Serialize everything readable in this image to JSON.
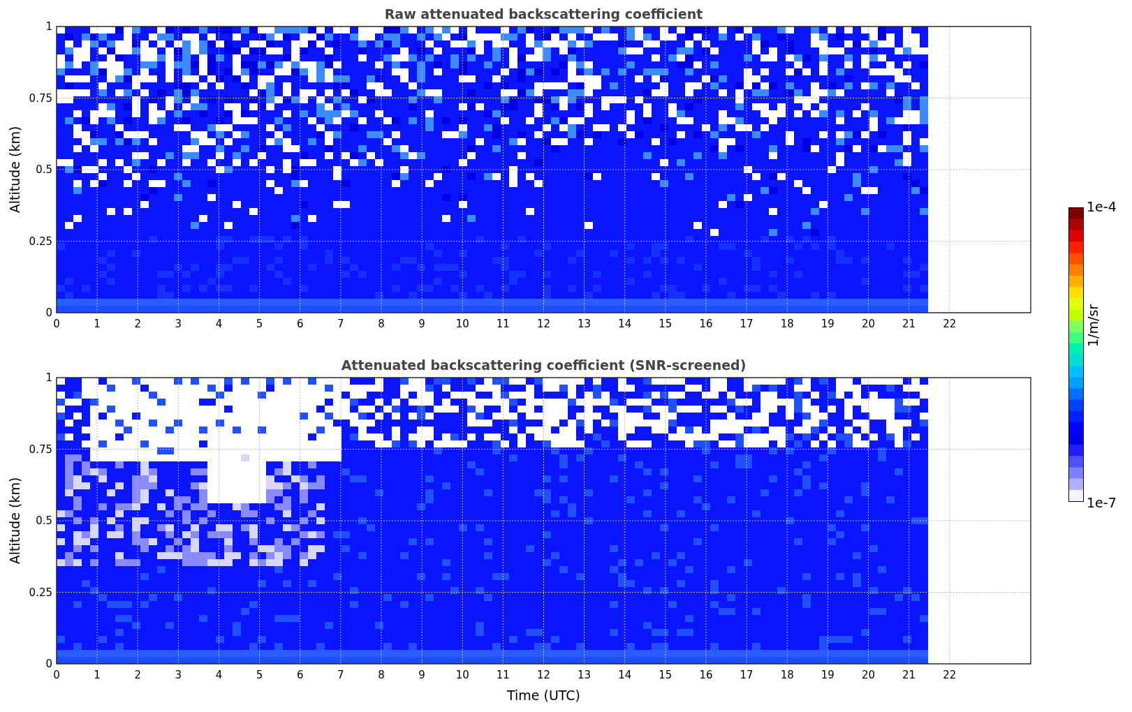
{
  "panels": [
    {
      "kind": "raw",
      "title": "Raw attenuated backscattering coefficient",
      "ylabel": "Altitude (km)",
      "yticks": [
        "1",
        "0.75",
        "0.5",
        "0.25",
        "0"
      ],
      "xticks": [
        "0",
        "1",
        "2",
        "3",
        "4",
        "5",
        "6",
        "7",
        "8",
        "9",
        "10",
        "11",
        "12",
        "13",
        "14",
        "15",
        "16",
        "17",
        "18",
        "19",
        "20",
        "21",
        "22"
      ]
    },
    {
      "kind": "screened",
      "title": "Attenuated backscattering coefficient (SNR-screened)",
      "ylabel": "Altitude (km)",
      "xlabel": "Time (UTC)",
      "yticks": [
        "1",
        "0.75",
        "0.5",
        "0.25",
        "0"
      ],
      "xticks": [
        "0",
        "1",
        "2",
        "3",
        "4",
        "5",
        "6",
        "7",
        "8",
        "9",
        "10",
        "11",
        "12",
        "13",
        "14",
        "15",
        "16",
        "17",
        "18",
        "19",
        "20",
        "21",
        "22"
      ]
    }
  ],
  "colorbar": {
    "label": "1/m/sr",
    "max": "1e-4",
    "min": "1e-7"
  }
}
